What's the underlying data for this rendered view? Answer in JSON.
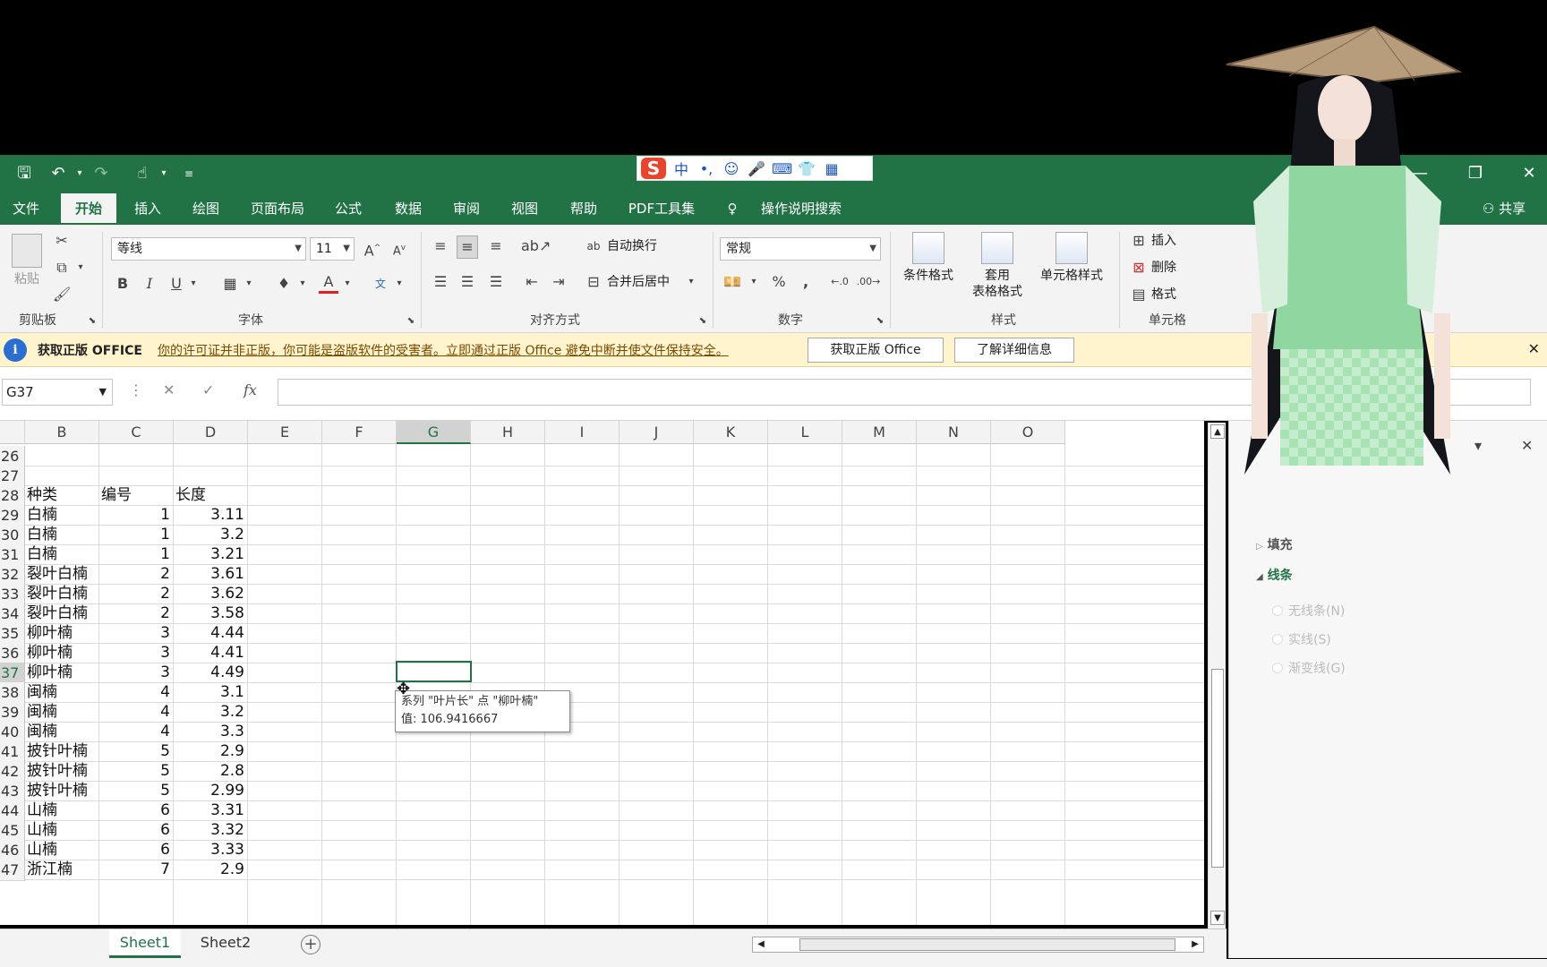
{
  "ime": {
    "items": [
      "中",
      "•,",
      "☺",
      "🎤",
      "⌨",
      "👕",
      "▦"
    ]
  },
  "ribbon_tabs": [
    "文件",
    "开始",
    "插入",
    "绘图",
    "页面布局",
    "公式",
    "数据",
    "审阅",
    "视图",
    "帮助",
    "PDF工具集"
  ],
  "active_tab": "开始",
  "tell_me": "操作说明搜索",
  "share": "共享",
  "ribbon": {
    "paste_label": "粘贴",
    "font_name": "等线",
    "font_size": "11",
    "wrap_text": "自动换行",
    "merge_center": "合并后居中",
    "number_format": "常规",
    "percent": "%",
    "comma": ",",
    "conditional_format": "条件格式",
    "format_as_table_1": "套用",
    "format_as_table_2": "表格格式",
    "cell_styles": "单元格样式",
    "insert": "插入",
    "delete": "删除",
    "format": "格式",
    "groups": {
      "clipboard": "剪贴板",
      "font": "字体",
      "alignment": "对齐方式",
      "number": "数字",
      "styles": "样式",
      "cells": "单元格"
    }
  },
  "message_bar": {
    "title": "获取正版 OFFICE",
    "text": "你的许可证并非正版，你可能是盗版软件的受害者。立即通过正版 Office 避免中断并使文件保持安全。",
    "btn_get": "获取正版 Office",
    "btn_learn": "了解详细信息"
  },
  "name_box": "G37",
  "columns": [
    "B",
    "C",
    "D",
    "E",
    "F",
    "G",
    "H",
    "I",
    "J",
    "K",
    "L",
    "M",
    "N",
    "O"
  ],
  "selected_column": "G",
  "rows": [
    {
      "n": "26",
      "b": "",
      "c": "",
      "d": ""
    },
    {
      "n": "27",
      "b": "",
      "c": "",
      "d": ""
    },
    {
      "n": "28",
      "b": "种类",
      "c": "编号",
      "d": "长度",
      "header": true
    },
    {
      "n": "29",
      "b": "白楠",
      "c": "1",
      "d": "3.11"
    },
    {
      "n": "30",
      "b": "白楠",
      "c": "1",
      "d": "3.2"
    },
    {
      "n": "31",
      "b": "白楠",
      "c": "1",
      "d": "3.21"
    },
    {
      "n": "32",
      "b": "裂叶白楠",
      "c": "2",
      "d": "3.61"
    },
    {
      "n": "33",
      "b": "裂叶白楠",
      "c": "2",
      "d": "3.62"
    },
    {
      "n": "34",
      "b": "裂叶白楠",
      "c": "2",
      "d": "3.58"
    },
    {
      "n": "35",
      "b": "柳叶楠",
      "c": "3",
      "d": "4.44"
    },
    {
      "n": "36",
      "b": "柳叶楠",
      "c": "3",
      "d": "4.41"
    },
    {
      "n": "37",
      "b": "柳叶楠",
      "c": "3",
      "d": "4.49"
    },
    {
      "n": "38",
      "b": "闽楠",
      "c": "4",
      "d": "3.1"
    },
    {
      "n": "39",
      "b": "闽楠",
      "c": "4",
      "d": "3.2"
    },
    {
      "n": "40",
      "b": "闽楠",
      "c": "4",
      "d": "3.3"
    },
    {
      "n": "41",
      "b": "披针叶楠",
      "c": "5",
      "d": "2.9"
    },
    {
      "n": "42",
      "b": "披针叶楠",
      "c": "5",
      "d": "2.8"
    },
    {
      "n": "43",
      "b": "披针叶楠",
      "c": "5",
      "d": "2.99"
    },
    {
      "n": "44",
      "b": "山楠",
      "c": "6",
      "d": "3.31"
    },
    {
      "n": "45",
      "b": "山楠",
      "c": "6",
      "d": "3.32"
    },
    {
      "n": "46",
      "b": "山楠",
      "c": "6",
      "d": "3.33"
    },
    {
      "n": "47",
      "b": "浙江楠",
      "c": "7",
      "d": "2.9"
    }
  ],
  "selected_row": "37",
  "tooltip": {
    "line1": "系列 \"叶片长\" 点 \"柳叶楠\"",
    "line2": "值: 106.9416667"
  },
  "sheets": [
    "Sheet1",
    "Sheet2"
  ],
  "active_sheet": "Sheet1",
  "format_pane": {
    "fill": "填充",
    "line": "线条",
    "options": [
      "无线条(N)",
      "实线(S)",
      "渐变线(G)"
    ]
  },
  "colors": {
    "excel_green": "#217346",
    "message_bar": "#fff4ce"
  }
}
